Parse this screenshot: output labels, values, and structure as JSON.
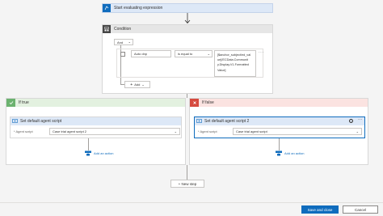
{
  "trigger": {
    "title": "Start evaluating expression",
    "icon": "flow-icon"
  },
  "condition": {
    "title": "Condition",
    "and_label": "And",
    "operand_left": "Auto dnp",
    "operator": "is equal to",
    "operand_right_lines": [
      "[$anchor_subject/ed_val",
      "ue]/ECData.Communit",
      "y.Display.V1.Formatted",
      "Value]"
    ],
    "add_label": "Add"
  },
  "if_true": {
    "title": "If true",
    "action_title": "Set default agent script",
    "field_label": "* Agent script",
    "field_value": "Case trial agent script 2",
    "add_action": "Add an action"
  },
  "if_false": {
    "title": "If false",
    "action_title": "Set default agent script 2",
    "field_label": "* Agent script",
    "field_value": "Case trial agent script",
    "add_action": "Add an action"
  },
  "new_step": "+ New step",
  "footer": {
    "save_label": "Save and close",
    "cancel_label": "Cancel"
  },
  "colors": {
    "accent": "#0f6cbd",
    "true_bg": "#e3f1e0",
    "true_icon": "#6bb26f",
    "false_bg": "#fbe3e1",
    "false_icon": "#d64a3f",
    "action_hdr": "#dde8f7"
  }
}
